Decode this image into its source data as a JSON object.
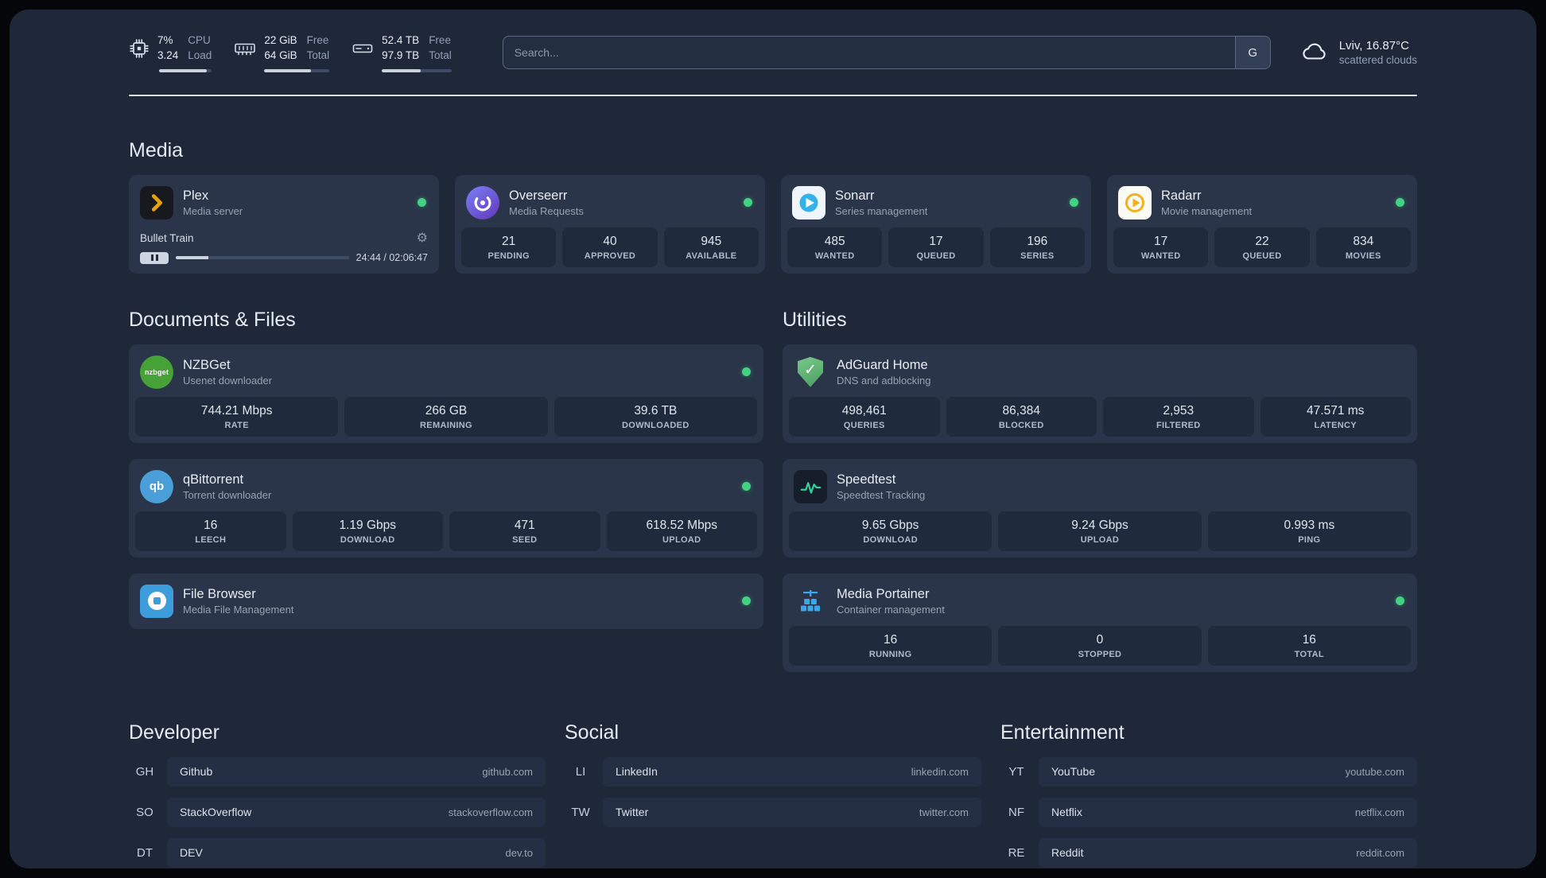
{
  "topbar": {
    "resources": [
      {
        "icon": "cpu-icon",
        "v1": "7%",
        "v2": "3.24",
        "l1": "CPU",
        "l2": "Load",
        "progress": 90
      },
      {
        "icon": "memory-icon",
        "v1": "22 GiB",
        "v2": "64 GiB",
        "l1": "Free",
        "l2": "Total",
        "progress": 72
      },
      {
        "icon": "disk-icon",
        "v1": "52.4 TB",
        "v2": "97.9 TB",
        "l1": "Free",
        "l2": "Total",
        "progress": 56
      }
    ],
    "search": {
      "placeholder": "Search...",
      "button_label": "G"
    },
    "weather": {
      "location": "Lviv, 16.87°C",
      "condition": "scattered clouds"
    }
  },
  "sections": {
    "media": {
      "title": "Media",
      "plex": {
        "name": "Plex",
        "subtitle": "Media server",
        "now_playing": "Bullet Train",
        "time": "24:44 / 02:06:47",
        "progress": 19
      },
      "overseerr": {
        "name": "Overseerr",
        "subtitle": "Media Requests",
        "stats": [
          {
            "value": "21",
            "label": "PENDING"
          },
          {
            "value": "40",
            "label": "APPROVED"
          },
          {
            "value": "945",
            "label": "AVAILABLE"
          }
        ]
      },
      "sonarr": {
        "name": "Sonarr",
        "subtitle": "Series management",
        "stats": [
          {
            "value": "485",
            "label": "WANTED"
          },
          {
            "value": "17",
            "label": "QUEUED"
          },
          {
            "value": "196",
            "label": "SERIES"
          }
        ]
      },
      "radarr": {
        "name": "Radarr",
        "subtitle": "Movie management",
        "stats": [
          {
            "value": "17",
            "label": "WANTED"
          },
          {
            "value": "22",
            "label": "QUEUED"
          },
          {
            "value": "834",
            "label": "MOVIES"
          }
        ]
      }
    },
    "documents": {
      "title": "Documents & Files",
      "nzbget": {
        "name": "NZBGet",
        "subtitle": "Usenet downloader",
        "stats": [
          {
            "value": "744.21 Mbps",
            "label": "RATE"
          },
          {
            "value": "266 GB",
            "label": "REMAINING"
          },
          {
            "value": "39.6 TB",
            "label": "DOWNLOADED"
          }
        ]
      },
      "qbittorrent": {
        "name": "qBittorrent",
        "subtitle": "Torrent downloader",
        "stats": [
          {
            "value": "16",
            "label": "LEECH"
          },
          {
            "value": "1.19 Gbps",
            "label": "DOWNLOAD"
          },
          {
            "value": "471",
            "label": "SEED"
          },
          {
            "value": "618.52 Mbps",
            "label": "UPLOAD"
          }
        ]
      },
      "filebrowser": {
        "name": "File Browser",
        "subtitle": "Media File Management"
      }
    },
    "utilities": {
      "title": "Utilities",
      "adguard": {
        "name": "AdGuard Home",
        "subtitle": "DNS and adblocking",
        "stats": [
          {
            "value": "498,461",
            "label": "QUERIES"
          },
          {
            "value": "86,384",
            "label": "BLOCKED"
          },
          {
            "value": "2,953",
            "label": "FILTERED"
          },
          {
            "value": "47.571 ms",
            "label": "LATENCY"
          }
        ]
      },
      "speedtest": {
        "name": "Speedtest",
        "subtitle": "Speedtest Tracking",
        "stats": [
          {
            "value": "9.65 Gbps",
            "label": "DOWNLOAD"
          },
          {
            "value": "9.24 Gbps",
            "label": "UPLOAD"
          },
          {
            "value": "0.993 ms",
            "label": "PING"
          }
        ]
      },
      "portainer": {
        "name": "Media Portainer",
        "subtitle": "Container management",
        "stats": [
          {
            "value": "16",
            "label": "RUNNING"
          },
          {
            "value": "0",
            "label": "STOPPED"
          },
          {
            "value": "16",
            "label": "TOTAL"
          }
        ]
      }
    }
  },
  "bookmarks": [
    {
      "title": "Developer",
      "items": [
        {
          "abbr": "GH",
          "name": "Github",
          "url": "github.com"
        },
        {
          "abbr": "SO",
          "name": "StackOverflow",
          "url": "stackoverflow.com"
        },
        {
          "abbr": "DT",
          "name": "DEV",
          "url": "dev.to"
        }
      ]
    },
    {
      "title": "Social",
      "items": [
        {
          "abbr": "LI",
          "name": "LinkedIn",
          "url": "linkedin.com"
        },
        {
          "abbr": "TW",
          "name": "Twitter",
          "url": "twitter.com"
        }
      ]
    },
    {
      "title": "Entertainment",
      "items": [
        {
          "abbr": "YT",
          "name": "YouTube",
          "url": "youtube.com"
        },
        {
          "abbr": "NF",
          "name": "Netflix",
          "url": "netflix.com"
        },
        {
          "abbr": "RE",
          "name": "Reddit",
          "url": "reddit.com"
        }
      ]
    }
  ]
}
